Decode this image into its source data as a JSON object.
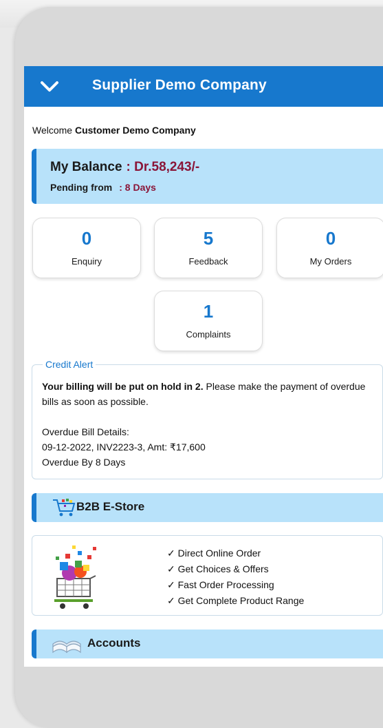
{
  "header": {
    "title": "Supplier Demo Company"
  },
  "welcome": {
    "prefix": "Welcome",
    "customer": "Customer Demo Company"
  },
  "balance": {
    "label": "My Balance",
    "value": ": Dr.58,243/-",
    "pending_label": "Pending from",
    "pending_value": ": 8 Days"
  },
  "stats": [
    {
      "count": "0",
      "label": "Enquiry"
    },
    {
      "count": "5",
      "label": "Feedback"
    },
    {
      "count": "0",
      "label": "My Orders"
    },
    {
      "count": "1",
      "label": "Complaints"
    }
  ],
  "credit_alert": {
    "legend": "Credit Alert",
    "bold_text": "Your billing will be put on hold in 2.",
    "rest_text": " Please make the payment of overdue bills as soon as possible.",
    "details_heading": "Overdue Bill Details:",
    "details_line": "09-12-2022, INV2223-3, Amt: ₹17,600",
    "overdue_line": "Overdue By 8 Days"
  },
  "estore": {
    "title": "B2B E-Store",
    "features": [
      "Direct Online Order",
      "Get Choices & Offers",
      "Fast Order Processing",
      "Get Complete Product Range"
    ]
  },
  "accounts": {
    "title": "Accounts"
  },
  "colors": {
    "primary": "#1778cd",
    "section_bg": "#b8e2fa",
    "balance_value": "#8a1538"
  }
}
